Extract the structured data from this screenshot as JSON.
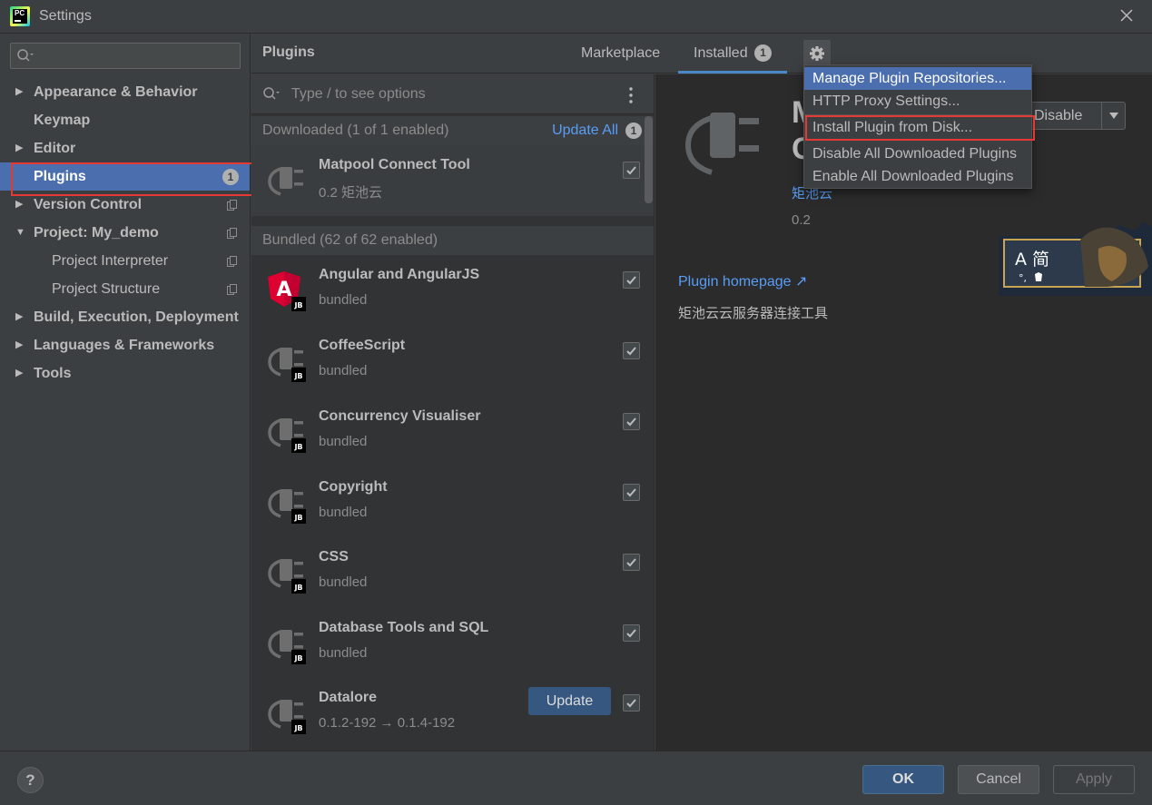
{
  "window": {
    "title": "Settings",
    "app_icon": "pycharm-logo",
    "app_icon_text": "PC"
  },
  "sidebar": {
    "search_placeholder": "",
    "items": [
      {
        "label": "Appearance & Behavior",
        "expandable": true
      },
      {
        "label": "Keymap",
        "expandable": false
      },
      {
        "label": "Editor",
        "expandable": true
      },
      {
        "label": "Plugins",
        "expandable": false,
        "selected": true,
        "badge": "1"
      },
      {
        "label": "Version Control",
        "expandable": true
      },
      {
        "label": "Project: My_demo",
        "expandable": true,
        "expanded": true
      },
      {
        "label": "Project Interpreter",
        "level": 2
      },
      {
        "label": "Project Structure",
        "level": 2
      },
      {
        "label": "Build, Execution, Deployment",
        "expandable": true
      },
      {
        "label": "Languages & Frameworks",
        "expandable": true
      },
      {
        "label": "Tools",
        "expandable": true
      }
    ]
  },
  "header": {
    "title": "Plugins",
    "tabs": [
      {
        "label": "Marketplace"
      },
      {
        "label": "Installed",
        "badge": "1",
        "active": true
      }
    ]
  },
  "plugin_list": {
    "search_placeholder": "Type / to see options",
    "sections": [
      {
        "label": "Downloaded (1 of 1 enabled)",
        "action": "Update All",
        "badge": "1"
      },
      {
        "label": "Bundled (62 of 62 enabled)"
      }
    ],
    "plugins": [
      {
        "name": "Matpool Connect Tool",
        "sub": "0.2  矩池云",
        "checked": true
      },
      {
        "name": "Angular and AngularJS",
        "sub": "bundled",
        "checked": true,
        "icon": "angular-icon"
      },
      {
        "name": "CoffeeScript",
        "sub": "bundled",
        "checked": true
      },
      {
        "name": "Concurrency Visualiser",
        "sub": "bundled",
        "checked": true
      },
      {
        "name": "Copyright",
        "sub": "bundled",
        "checked": true
      },
      {
        "name": "CSS",
        "sub": "bundled",
        "checked": true
      },
      {
        "name": "Database Tools and SQL",
        "sub": "bundled",
        "checked": true
      },
      {
        "name": "Datalore",
        "sub": "0.1.2-192 → 0.1.4-192",
        "checked": true,
        "update_label": "Update"
      }
    ],
    "jb_badge": "JB",
    "angular_letter": "A"
  },
  "details": {
    "title_line1": "M",
    "title_line2": "C",
    "vendor": "矩池云",
    "version": "0.2",
    "homepage": "Plugin homepage ↗",
    "description": "矩池云云服务器连接工具",
    "disable_label": "Disable",
    "ime_text": "A 简",
    "ime_text2": "°,"
  },
  "gear_menu": {
    "items": [
      {
        "label": "Manage Plugin Repositories...",
        "active": true
      },
      {
        "label": "HTTP Proxy Settings..."
      },
      {
        "label": "Install Plugin from Disk..."
      },
      {
        "label": "Disable All Downloaded Plugins"
      },
      {
        "label": "Enable All Downloaded Plugins"
      }
    ]
  },
  "footer": {
    "help": "?",
    "ok": "OK",
    "cancel": "Cancel",
    "apply": "Apply"
  },
  "colors": {
    "background": "#3c3f41",
    "selection": "#4b6eaf",
    "link": "#589df6",
    "highlight": "#e53935",
    "primary_button": "#365880"
  }
}
